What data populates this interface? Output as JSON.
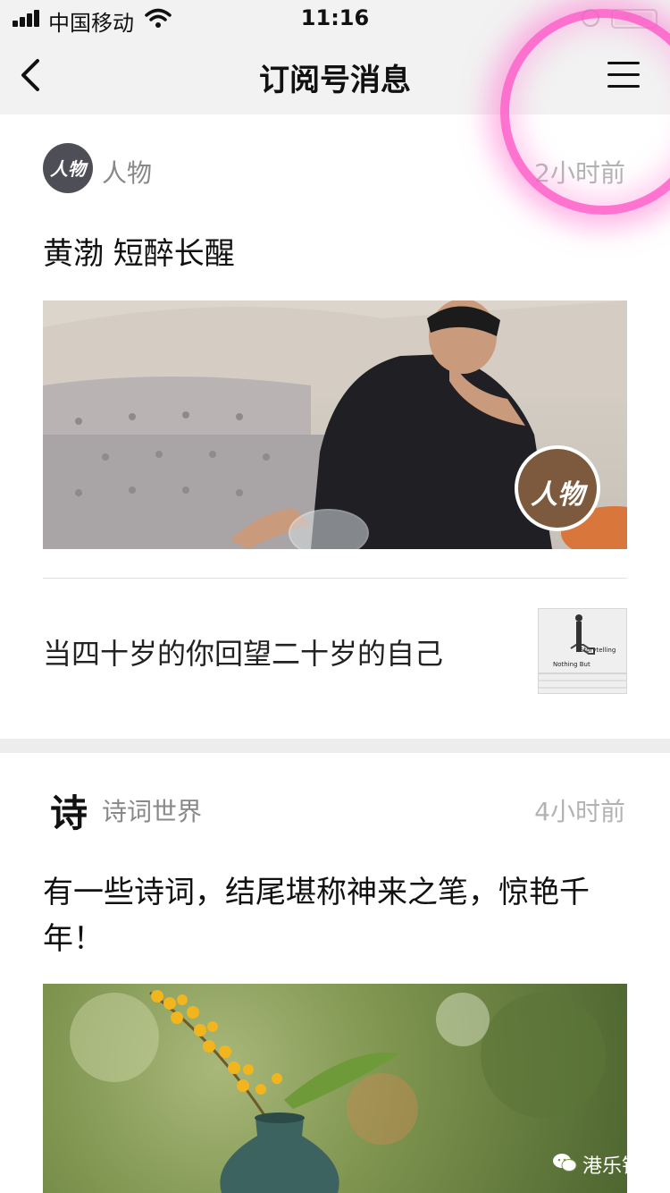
{
  "status_bar": {
    "carrier": "中国移动",
    "time": "11:16",
    "battery_level": 0.95
  },
  "nav": {
    "title": "订阅号消息"
  },
  "feed": [
    {
      "account": "人物",
      "avatar_text": "人物",
      "time": "2小时前",
      "headline": "黄渤 短醉长醒",
      "cover_badge": "人物",
      "sub_articles": [
        {
          "title": "当四十岁的你回望二十岁的自己",
          "thumb_text_1": "Storytelling",
          "thumb_text_2": "Nothing But"
        }
      ]
    },
    {
      "account": "诗词世界",
      "avatar_text": "诗",
      "time": "4小时前",
      "headline": "有一些诗词，结尾堪称神来之笔，惊艳千年！"
    }
  ],
  "watermark": {
    "text": "港乐钩沉"
  }
}
